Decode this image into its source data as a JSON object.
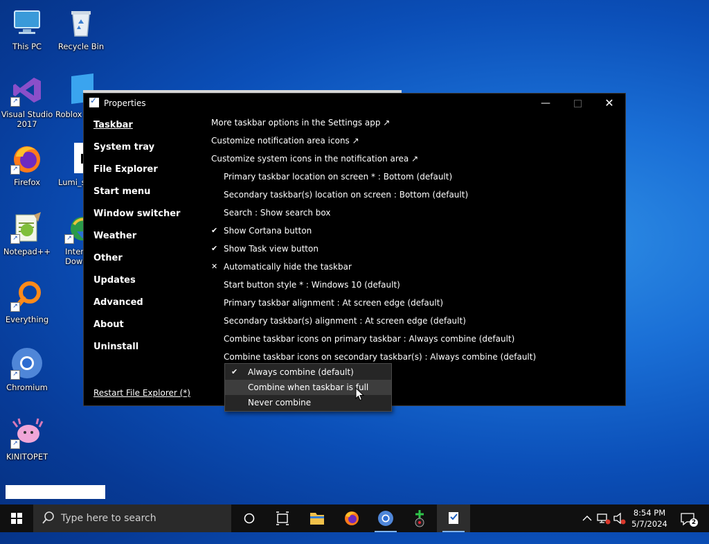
{
  "desktop": {
    "icons": [
      {
        "label": "This PC"
      },
      {
        "label": "Recycle Bin"
      },
      {
        "label": "Visual Studio\n2017"
      },
      {
        "label": "Roblox"
      },
      {
        "label": "Firefox"
      },
      {
        "label": "Lumi_s"
      },
      {
        "label": "Notepad++"
      },
      {
        "label": "Inter\nDown"
      },
      {
        "label": "Everything"
      },
      {
        "label": "Chromium"
      },
      {
        "label": "KINITOPET"
      }
    ]
  },
  "window": {
    "title": "Properties",
    "controls": {
      "minimize": "—",
      "close": "✕"
    },
    "nav": [
      {
        "label": "Taskbar",
        "active": true
      },
      {
        "label": "System tray"
      },
      {
        "label": "File Explorer"
      },
      {
        "label": "Start menu"
      },
      {
        "label": "Window switcher"
      },
      {
        "label": "Weather"
      },
      {
        "label": "Other"
      },
      {
        "label": "Updates"
      },
      {
        "label": "Advanced"
      },
      {
        "label": "About"
      },
      {
        "label": "Uninstall"
      }
    ],
    "restart_link": "Restart File Explorer (*)",
    "options": [
      {
        "label": "More taskbar options in the Settings app ↗",
        "indent": false,
        "mark": ""
      },
      {
        "label": "Customize notification area icons ↗",
        "indent": false,
        "mark": ""
      },
      {
        "label": "Customize system icons in the notification area ↗",
        "indent": false,
        "mark": ""
      },
      {
        "label": "Primary taskbar location on screen * : Bottom (default)",
        "indent": true,
        "mark": ""
      },
      {
        "label": "Secondary taskbar(s) location on screen : Bottom (default)",
        "indent": true,
        "mark": ""
      },
      {
        "label": "Search : Show search box",
        "indent": true,
        "mark": ""
      },
      {
        "label": "Show Cortana button",
        "indent": true,
        "mark": "✔"
      },
      {
        "label": "Show Task view button",
        "indent": true,
        "mark": "✔"
      },
      {
        "label": "Automatically hide the taskbar",
        "indent": true,
        "mark": "✕"
      },
      {
        "label": "Start button style * : Windows 10 (default)",
        "indent": true,
        "mark": ""
      },
      {
        "label": "Primary taskbar alignment : At screen edge (default)",
        "indent": true,
        "mark": ""
      },
      {
        "label": "Secondary taskbar(s) alignment : At screen edge (default)",
        "indent": true,
        "mark": ""
      },
      {
        "label": "Combine taskbar icons on primary taskbar : Always combine (default)",
        "indent": true,
        "mark": ""
      },
      {
        "label": "Combine taskbar icons on secondary taskbar(s) : Always combine (default)",
        "indent": true,
        "mark": ""
      }
    ]
  },
  "dropdown": {
    "items": [
      {
        "label": "Always combine (default)",
        "checked": true,
        "mark": "✔"
      },
      {
        "label": "Combine when taskbar is full",
        "hovered": true
      },
      {
        "label": "Never combine"
      }
    ]
  },
  "taskbar": {
    "search_placeholder": "Type here to search",
    "clock_time": "8:54 PM",
    "clock_date": "5/7/2024",
    "notification_count": "2",
    "accent": "#7fb4ef"
  }
}
